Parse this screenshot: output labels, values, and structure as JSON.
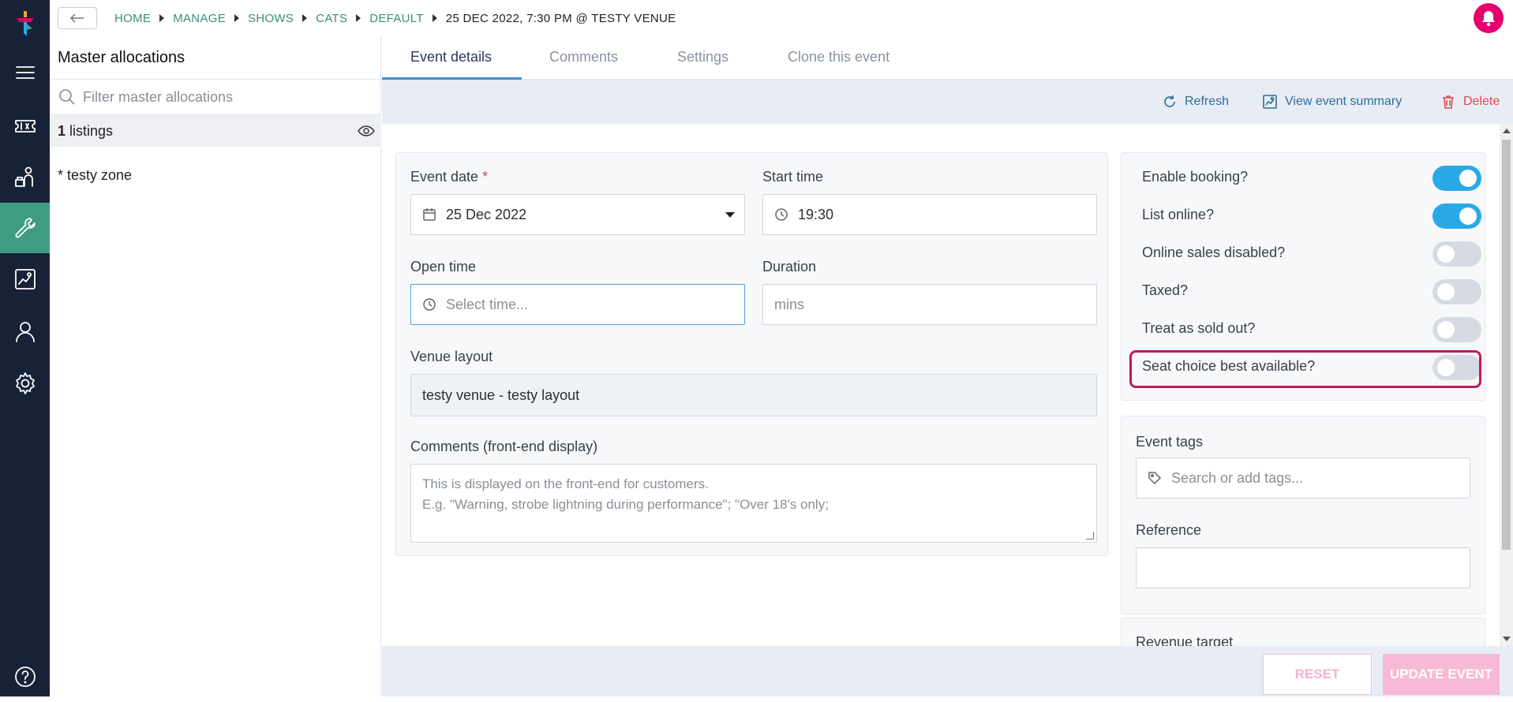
{
  "breadcrumb": {
    "items": [
      "HOME",
      "MANAGE",
      "SHOWS",
      "CATS",
      "DEFAULT"
    ],
    "current": "25 DEC 2022, 7:30 PM @ TESTY VENUE"
  },
  "allocations": {
    "title": "Master allocations",
    "filter_placeholder": "Filter master allocations",
    "listings_count": "1",
    "listings_label": "listings",
    "zone": "* testy zone"
  },
  "tabs": [
    "Event details",
    "Comments",
    "Settings",
    "Clone this event"
  ],
  "actions": {
    "refresh": "Refresh",
    "view_summary": "View event summary",
    "delete": "Delete"
  },
  "form": {
    "event_date_label": "Event date",
    "event_date_required": "*",
    "event_date_value": "25 Dec 2022",
    "start_time_label": "Start time",
    "start_time_value": "19:30",
    "open_time_label": "Open time",
    "open_time_placeholder": "Select time...",
    "duration_label": "Duration",
    "duration_placeholder": "mins",
    "venue_layout_label": "Venue layout",
    "venue_layout_value": "testy venue - testy layout",
    "comments_label": "Comments (front-end display)",
    "comments_placeholder_1": "This is displayed on the front-end for customers.",
    "comments_placeholder_2": "E.g. \"Warning, strobe lightning during performance\"; \"Over 18's only;"
  },
  "toggles": [
    {
      "label": "Enable booking?",
      "on": true
    },
    {
      "label": "List online?",
      "on": true
    },
    {
      "label": "Online sales disabled?",
      "on": false
    },
    {
      "label": "Taxed?",
      "on": false
    },
    {
      "label": "Treat as sold out?",
      "on": false
    },
    {
      "label": "Seat choice best available?",
      "on": false
    }
  ],
  "side": {
    "event_tags_label": "Event tags",
    "tags_placeholder": "Search or add tags...",
    "reference_label": "Reference",
    "revenue_target_label": "Revenue target"
  },
  "buttons": {
    "reset": "RESET",
    "update": "UPDATE EVENT"
  },
  "colors": {
    "sidebar": "#172238",
    "active_nav": "#3f9b82",
    "accent_pink": "#e5006e",
    "toggle_on": "#29a9e8",
    "highlight": "#c0185c"
  }
}
